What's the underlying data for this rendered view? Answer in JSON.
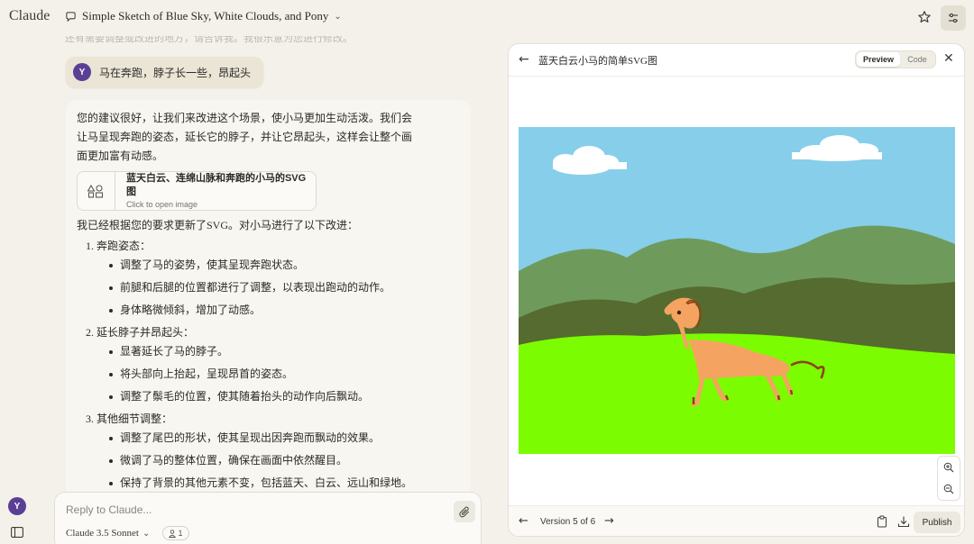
{
  "app": {
    "brand": "Claude"
  },
  "header": {
    "chat_title": "Simple Sketch of Blue Sky, White Clouds, and Pony"
  },
  "chat": {
    "faded_text": "还有需要调整或改进的地方，请告诉我。我很乐意为您进行修改。",
    "user_avatar": "Y",
    "user_message": "马在奔跑，脖子长一些，昂起头",
    "assistant": {
      "intro": "您的建议很好，让我们来改进这个场景，使小马更加生动活泼。我们会让马呈现奔跑的姿态，延长它的脖子，并让它昂起头，这样会让整个画面更加富有动感。",
      "artifact_title": "蓝天白云、连绵山脉和奔跑的小马的SVG图",
      "artifact_sub": "Click to open image",
      "summary": "我已经根据您的要求更新了SVG。对小马进行了以下改进：",
      "list": [
        {
          "head": "1. 奔跑姿态：",
          "items": [
            "调整了马的姿势，使其呈现奔跑状态。",
            "前腿和后腿的位置都进行了调整，以表现出跑动的动作。",
            "身体略微倾斜，增加了动感。"
          ]
        },
        {
          "head": "2. 延长脖子并昂起头：",
          "items": [
            "显著延长了马的脖子。",
            "将头部向上抬起，呈现昂首的姿态。",
            "调整了鬃毛的位置，使其随着抬头的动作向后飘动。"
          ]
        },
        {
          "head": "3. 其他细节调整：",
          "items": [
            "调整了尾巴的形状，使其呈现出因奔跑而飘动的效果。",
            "微调了马的整体位置，确保在画面中依然醒目。",
            "保持了背景的其他元素不变，包括蓝天、白云、远山和绿地。"
          ]
        }
      ]
    }
  },
  "input": {
    "placeholder": "Reply to Claude...",
    "model": "Claude 3.5 Sonnet",
    "style_count": "1"
  },
  "panel": {
    "title": "蓝天白云小马的简单SVG图",
    "preview_label": "Preview",
    "code_label": "Code",
    "version": "Version 5 of 6",
    "publish_label": "Publish"
  },
  "colors": {
    "sky": "#87ceeb",
    "far_hills": "#6e9b5c",
    "near_hills": "#556b2f",
    "grass": "#7cfc00",
    "pony": "#f4a460",
    "mane": "#8b4513",
    "avatar": "#5b3f94"
  },
  "icons": {
    "chat": "chat-bubble-icon",
    "star": "star-icon",
    "tune": "sliders-icon",
    "attach": "paperclip-icon",
    "artifact": "shapes-icon",
    "zoom_in": "zoom-in-icon",
    "zoom_out": "zoom-out-icon",
    "copy": "clipboard-icon",
    "download": "download-icon"
  }
}
